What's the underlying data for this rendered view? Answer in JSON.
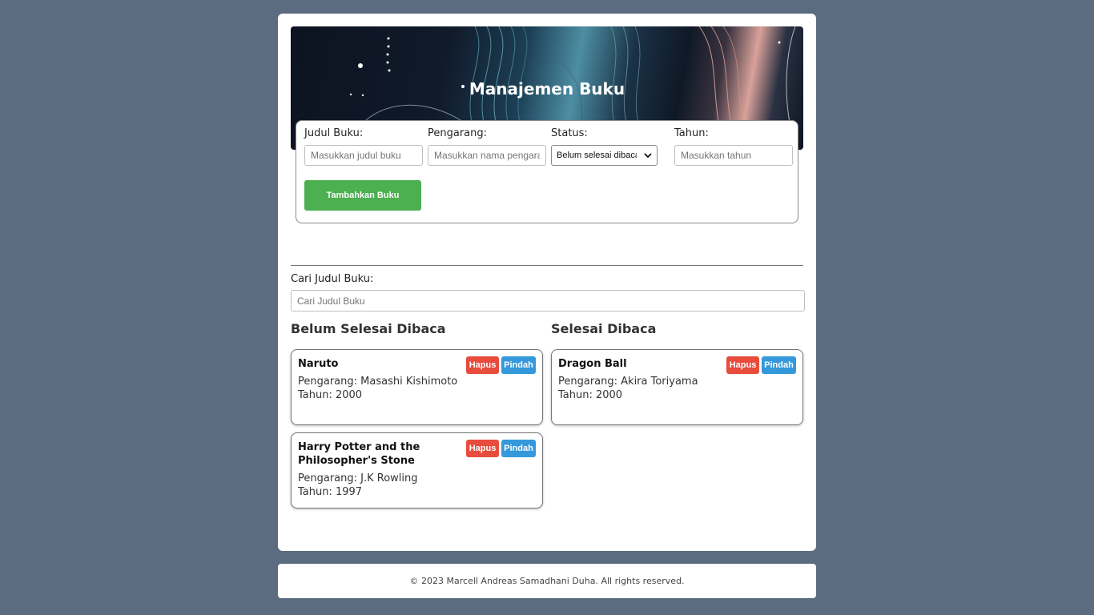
{
  "header": {
    "title": "Manajemen Buku"
  },
  "form": {
    "title_label": "Judul Buku:",
    "title_placeholder": "Masukkan judul buku",
    "author_label": "Pengarang:",
    "author_placeholder": "Masukkan nama pengarang",
    "status_label": "Status:",
    "status_selected": "Belum selesai dibaca",
    "year_label": "Tahun:",
    "year_placeholder": "Masukkan tahun",
    "submit_label": "Tambahkan Buku"
  },
  "search": {
    "label": "Cari Judul Buku:",
    "placeholder": "Cari Judul Buku"
  },
  "columns": {
    "unread_title": "Belum Selesai Dibaca",
    "read_title": "Selesai Dibaca"
  },
  "books_unread": [
    {
      "title": "Naruto",
      "author": "Pengarang: Masashi Kishimoto",
      "year": "Tahun: 2000",
      "delete_label": "Hapus",
      "move_label": "Pindah"
    },
    {
      "title": "Harry Potter and the Philosopher's Stone",
      "author": "Pengarang: J.K Rowling",
      "year": "Tahun: 1997",
      "delete_label": "Hapus",
      "move_label": "Pindah"
    }
  ],
  "books_read": [
    {
      "title": "Dragon Ball",
      "author": "Pengarang: Akira Toriyama",
      "year": "Tahun: 2000",
      "delete_label": "Hapus",
      "move_label": "Pindah"
    }
  ],
  "footer": {
    "text": "© 2023 Marcell Andreas Samadhani Duha. All rights reserved."
  },
  "colors": {
    "background": "#5b6c80",
    "add_button": "#4caf50",
    "delete_button": "#e74c3c",
    "move_button": "#3498db"
  },
  "icons": {
    "select_arrow": "chevron-down-icon"
  }
}
